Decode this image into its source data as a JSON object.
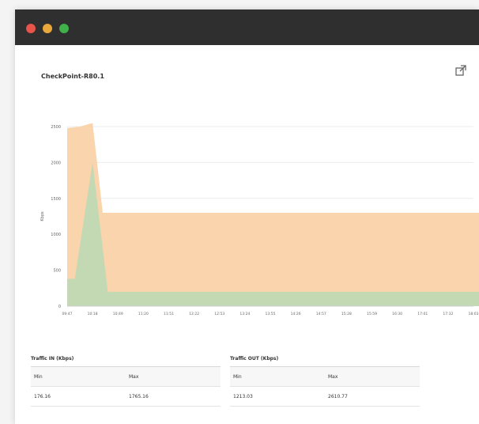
{
  "window": {
    "controls": [
      "close",
      "minimize",
      "zoom"
    ],
    "colors": {
      "titlebar": "#2f2f2f",
      "close": "#e8534a",
      "minimize": "#e9a93a",
      "zoom": "#3fb04a"
    }
  },
  "widget": {
    "title": "CheckPoint-R80.1",
    "popout_icon": "external-link-icon"
  },
  "chart_data": {
    "type": "area",
    "ylabel": "Kbps",
    "ylim": [
      0,
      2500
    ],
    "yticks": [
      0,
      500,
      1000,
      1500,
      2000,
      2500
    ],
    "ytick_labels": [
      "0",
      "500",
      "1000",
      "1500",
      "2000",
      "2500"
    ],
    "x_labels": [
      "09:47",
      "10:18",
      "10:49",
      "11:20",
      "11:51",
      "12:22",
      "12:53",
      "13:24",
      "13:55",
      "14:26",
      "14:57",
      "15:28",
      "15:59",
      "16:30",
      "17:01",
      "17:32",
      "18:03"
    ],
    "grid": true,
    "series": [
      {
        "name": "Traffic OUT",
        "color": "#f9d2a8",
        "points": [
          [
            0,
            2480
          ],
          [
            0.5,
            2500
          ],
          [
            1.0,
            2550
          ],
          [
            1.4,
            1300
          ],
          [
            16.8,
            1300
          ]
        ]
      },
      {
        "name": "Traffic IN",
        "color": "#bfd9b4",
        "points": [
          [
            0,
            380
          ],
          [
            0.3,
            380
          ],
          [
            1.0,
            2000
          ],
          [
            1.6,
            200
          ],
          [
            16.8,
            200
          ]
        ]
      }
    ]
  },
  "tables": {
    "in": {
      "title": "Traffic IN (Kbps)",
      "col_min": "Min",
      "col_max": "Max",
      "min": "176.16",
      "max": "1765.16"
    },
    "out": {
      "title": "Traffic OUT (Kbps)",
      "col_min": "Min",
      "col_max": "Max",
      "min": "1213.03",
      "max": "2610.77"
    }
  }
}
